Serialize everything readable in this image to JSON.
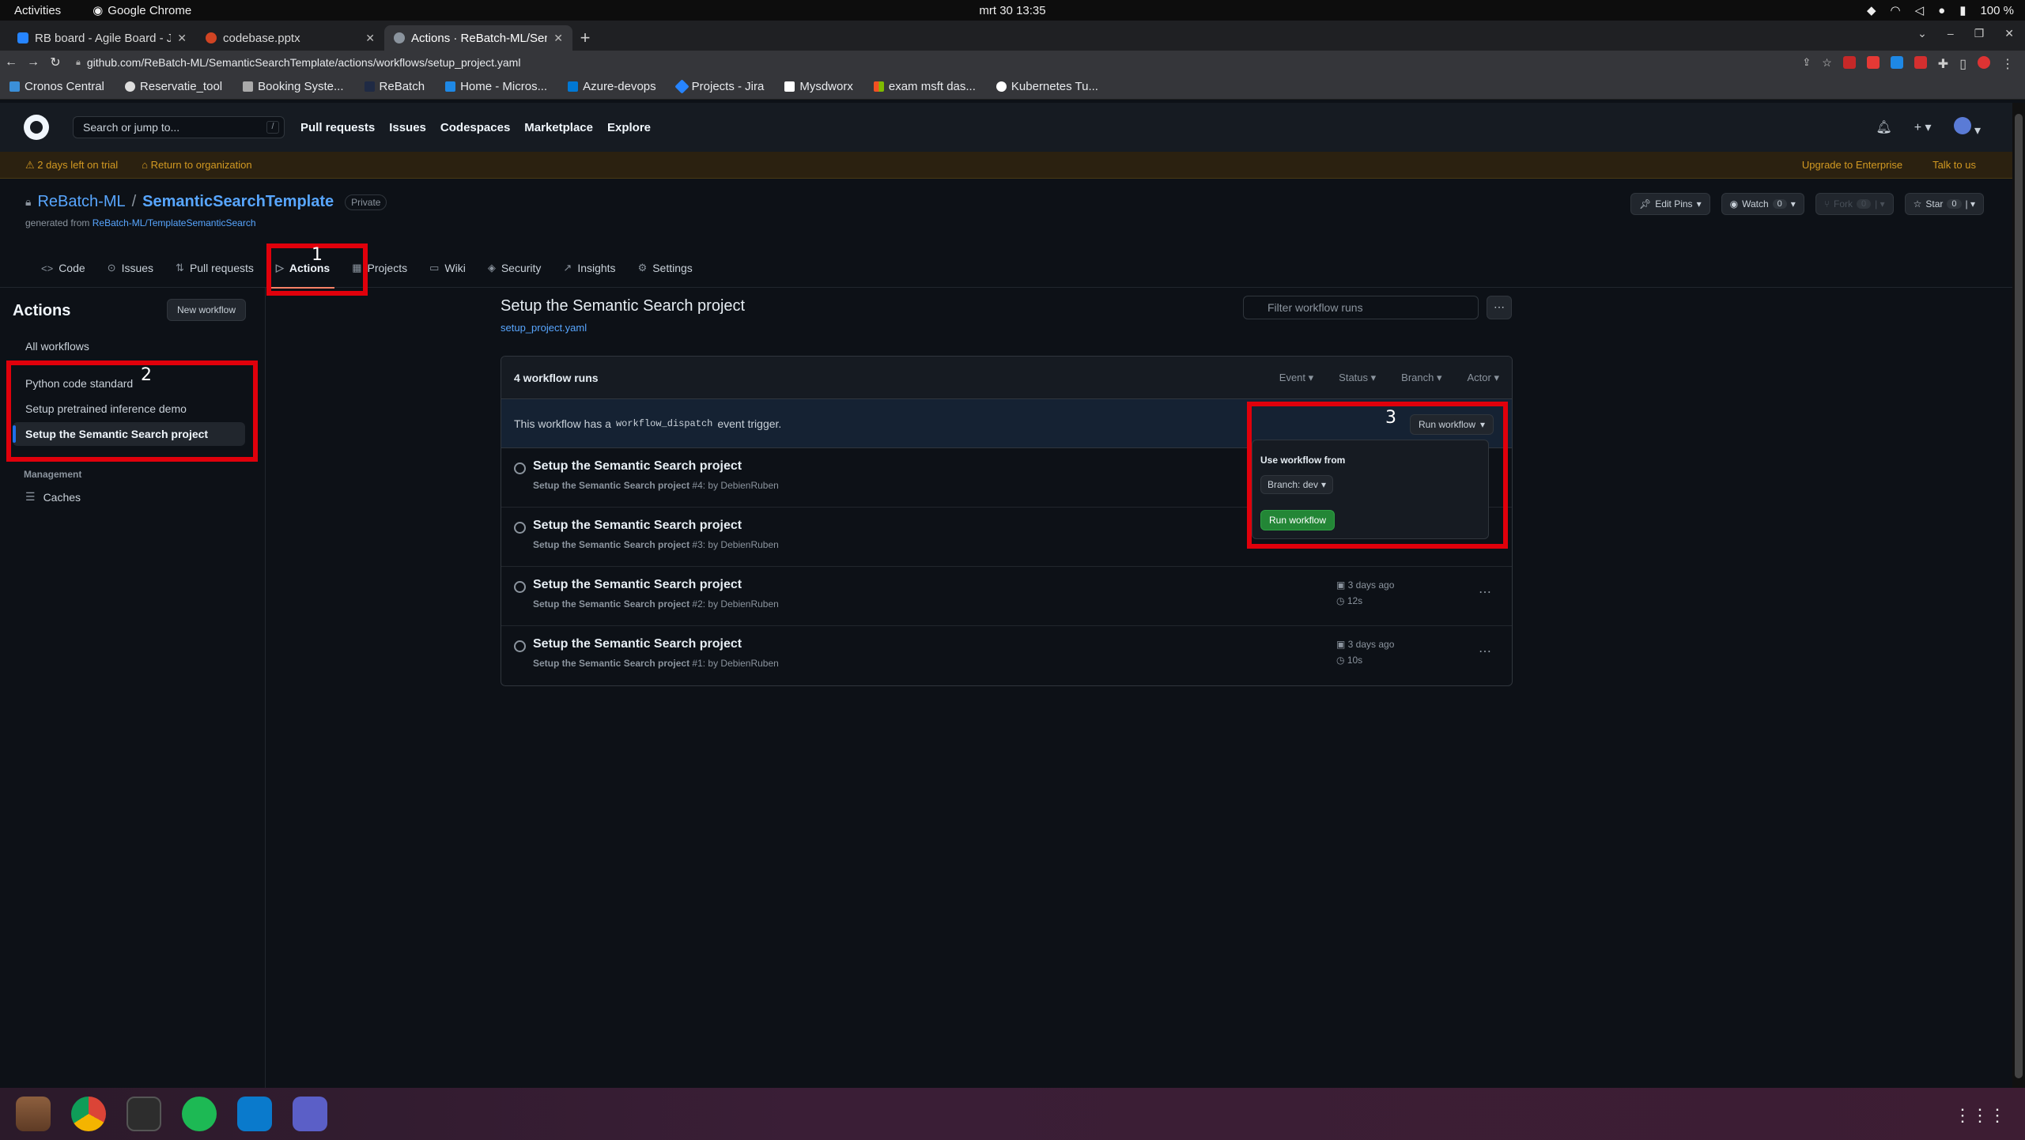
{
  "os": {
    "activities": "Activities",
    "app_name": "Google Chrome",
    "clock": "mrt 30  13:35",
    "battery": "100 %"
  },
  "browser": {
    "tabs": [
      {
        "title": "RB board - Agile Board - J",
        "color": "#2684ff"
      },
      {
        "title": "codebase.pptx",
        "color": "#d04423"
      },
      {
        "title": "Actions · ReBatch-ML/Sen",
        "color": "#8b949e"
      }
    ],
    "url": "github.com/ReBatch-ML/SemanticSearchTemplate/actions/workflows/setup_project.yaml",
    "bookmarks": [
      {
        "label": "Cronos Central",
        "color": "#3b8fd8"
      },
      {
        "label": "Reservatie_tool",
        "color": "#dddddd"
      },
      {
        "label": "Booking Syste...",
        "color": "#aaaaaa"
      },
      {
        "label": "ReBatch",
        "color": "#1f2a44"
      },
      {
        "label": "Home - Micros...",
        "color": "#1e88e5"
      },
      {
        "label": "Azure-devops",
        "color": "#0078d4"
      },
      {
        "label": "Projects - Jira",
        "color": "#2684ff"
      },
      {
        "label": "Mysdworx",
        "color": "#ffffff"
      },
      {
        "label": "exam msft das...",
        "color": "#f25022"
      },
      {
        "label": "Kubernetes Tu...",
        "color": "#ffffff"
      }
    ]
  },
  "github": {
    "search_placeholder": "Search or jump to...",
    "search_shortcut": "/",
    "nav": [
      "Pull requests",
      "Issues",
      "Codespaces",
      "Marketplace",
      "Explore"
    ],
    "trial": {
      "days_left": "2 days left on trial",
      "return": "Return to organization",
      "upgrade": "Upgrade to Enterprise",
      "talk": "Talk to us"
    },
    "repo": {
      "owner": "ReBatch-ML",
      "sep": "/",
      "name": "SemanticSearchTemplate",
      "visibility": "Private",
      "generated_prefix": "generated from",
      "generated_from": "ReBatch-ML/TemplateSemanticSearch",
      "edit_pins": "Edit Pins",
      "watch": "Watch",
      "watch_count": "0",
      "fork": "Fork",
      "fork_count": "0",
      "star": "Star",
      "star_count": "0"
    },
    "tabs": [
      "Code",
      "Issues",
      "Pull requests",
      "Actions",
      "Projects",
      "Wiki",
      "Security",
      "Insights",
      "Settings"
    ]
  },
  "sidebar": {
    "title": "Actions",
    "new_workflow": "New workflow",
    "all_workflows": "All workflows",
    "workflows": [
      "Python code standard",
      "Setup pretrained inference demo",
      "Setup the Semantic Search project"
    ],
    "management": "Management",
    "caches": "Caches"
  },
  "main": {
    "title": "Setup the Semantic Search project",
    "file": "setup_project.yaml",
    "filter_placeholder": "Filter workflow runs",
    "kebab": "⋯",
    "runs_count": "4 workflow runs",
    "filters": [
      "Event",
      "Status",
      "Branch",
      "Actor"
    ],
    "dispatch_prefix": "This workflow has a",
    "dispatch_code": "workflow_dispatch",
    "dispatch_suffix": "event trigger.",
    "runs": [
      {
        "name": "Setup the Semantic Search project",
        "workflow": "Setup the Semantic Search project",
        "meta": "#4: by DebienRuben",
        "date": "",
        "duration": ""
      },
      {
        "name": "Setup the Semantic Search project",
        "workflow": "Setup the Semantic Search project",
        "meta": "#3: by DebienRuben",
        "date": "",
        "duration": ""
      },
      {
        "name": "Setup the Semantic Search project",
        "workflow": "Setup the Semantic Search project",
        "meta": "#2: by DebienRuben",
        "date": "3 days ago",
        "duration": "12s"
      },
      {
        "name": "Setup the Semantic Search project",
        "workflow": "Setup the Semantic Search project",
        "meta": "#1: by DebienRuben",
        "date": "3 days ago",
        "duration": "10s"
      }
    ],
    "run_workflow": {
      "button": "Run workflow",
      "use_from": "Use workflow from",
      "branch": "Branch: dev",
      "submit": "Run workflow"
    }
  },
  "annotations": {
    "one": "1",
    "two": "2",
    "three": "3",
    "color": "#e0000b"
  }
}
